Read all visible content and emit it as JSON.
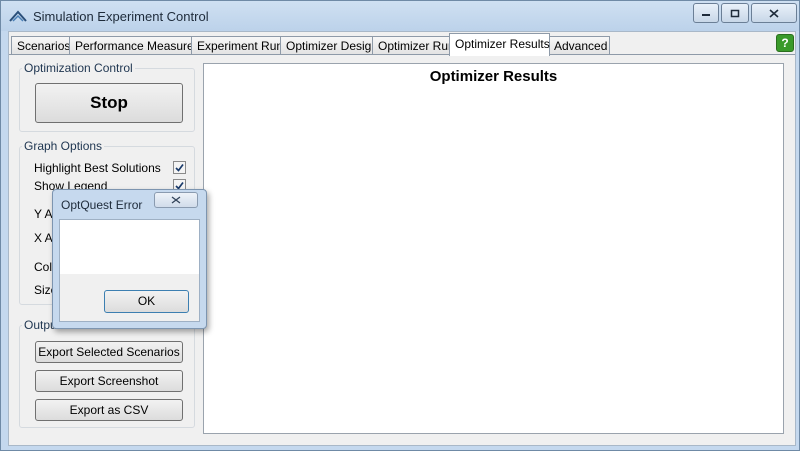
{
  "window": {
    "title": "Simulation Experiment Control",
    "accent_color": "#c4d8ee"
  },
  "tabs": [
    {
      "label": "Scenarios"
    },
    {
      "label": "Performance Measures"
    },
    {
      "label": "Experiment Run"
    },
    {
      "label": "Optimizer Design"
    },
    {
      "label": "Optimizer Run"
    },
    {
      "label": "Optimizer Results",
      "selected": true
    },
    {
      "label": "Advanced"
    }
  ],
  "help_button": {
    "label": "?",
    "icon": "help-icon",
    "color": "#3a9a2a"
  },
  "optimization_control": {
    "group_title": "Optimization Control",
    "stop_label": "Stop"
  },
  "graph_options": {
    "group_title": "Graph Options",
    "highlight_best_label": "Highlight Best Solutions",
    "highlight_best_checked": true,
    "show_legend_label": "Show Legend",
    "show_legend_checked": true,
    "y_axis_label_partial": "Y Ax",
    "x_axis_label_partial": "X Ax",
    "color_label_partial": "Colo",
    "size_label_partial": "Size"
  },
  "output": {
    "group_title_partial": "Output",
    "export_selected_label": "Export Selected Scenarios",
    "export_screenshot_label": "Export Screenshot",
    "export_csv_label": "Export as CSV"
  },
  "results": {
    "title": "Optimizer Results"
  },
  "error_dialog": {
    "title": "OptQuest Error",
    "message": "",
    "ok_label": "OK"
  }
}
